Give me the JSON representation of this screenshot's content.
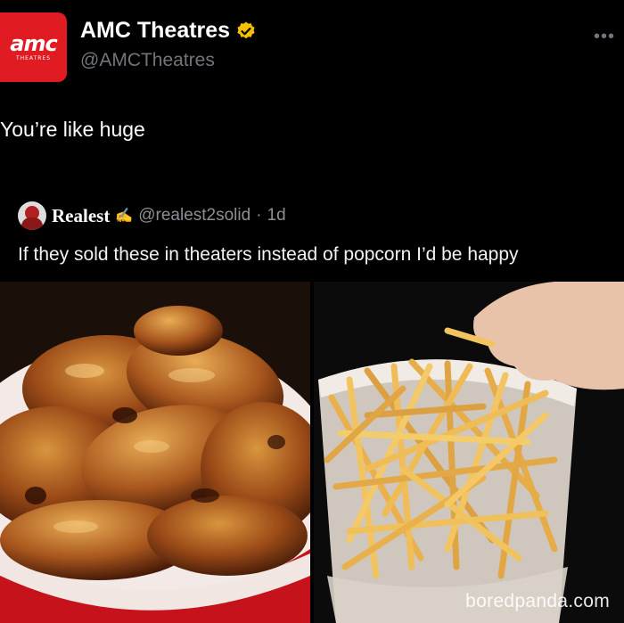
{
  "tweet": {
    "author_name": "AMC Theatres",
    "author_handle": "@AMCTheatres",
    "logo_word": "amc",
    "logo_sub": "THEATRES",
    "more_icon": "more-dots-icon",
    "verified_color": "#f5c000",
    "text": "You’re like huge"
  },
  "quote": {
    "author_name": "Realest",
    "author_handle": "@realest2solid",
    "separator": "·",
    "time": "1d",
    "text": "If they sold these in theaters instead of popcorn I’d be happy"
  },
  "media": {
    "left_image": "chicken-wings-bucket",
    "right_image": "french-fries-bucket"
  },
  "watermark": "boredpanda.com",
  "colors": {
    "background": "#000000",
    "brand": "#e01b22",
    "muted": "#71767b"
  }
}
